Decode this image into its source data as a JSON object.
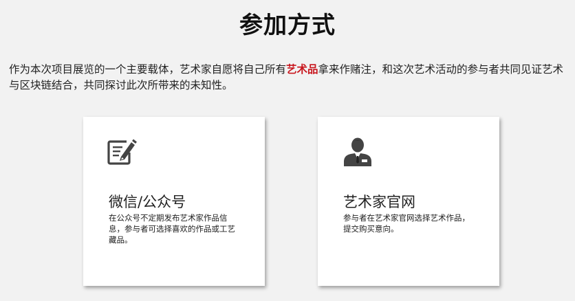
{
  "page": {
    "title": "参加方式"
  },
  "intro": {
    "text_before": "作为本次项目展览的一个主要载体，艺术家自愿将自己所有",
    "highlight": "艺术品",
    "text_after": "拿来作赌注，和这次艺术活动的参与者共同见证艺术与区块链结合，共同探讨此次所带来的未知性。",
    "highlight_color": "#c8161d"
  },
  "cards": [
    {
      "icon": "edit-note-icon",
      "title": "微信/公众号",
      "description": "在公众号不定期发布艺术家作品信息，参与者可选择喜欢的作品或工艺藏品。"
    },
    {
      "icon": "person-icon",
      "title": "艺术家官网",
      "description": "参与者在艺术家官网选择艺术作品，提交购买意向。"
    }
  ]
}
